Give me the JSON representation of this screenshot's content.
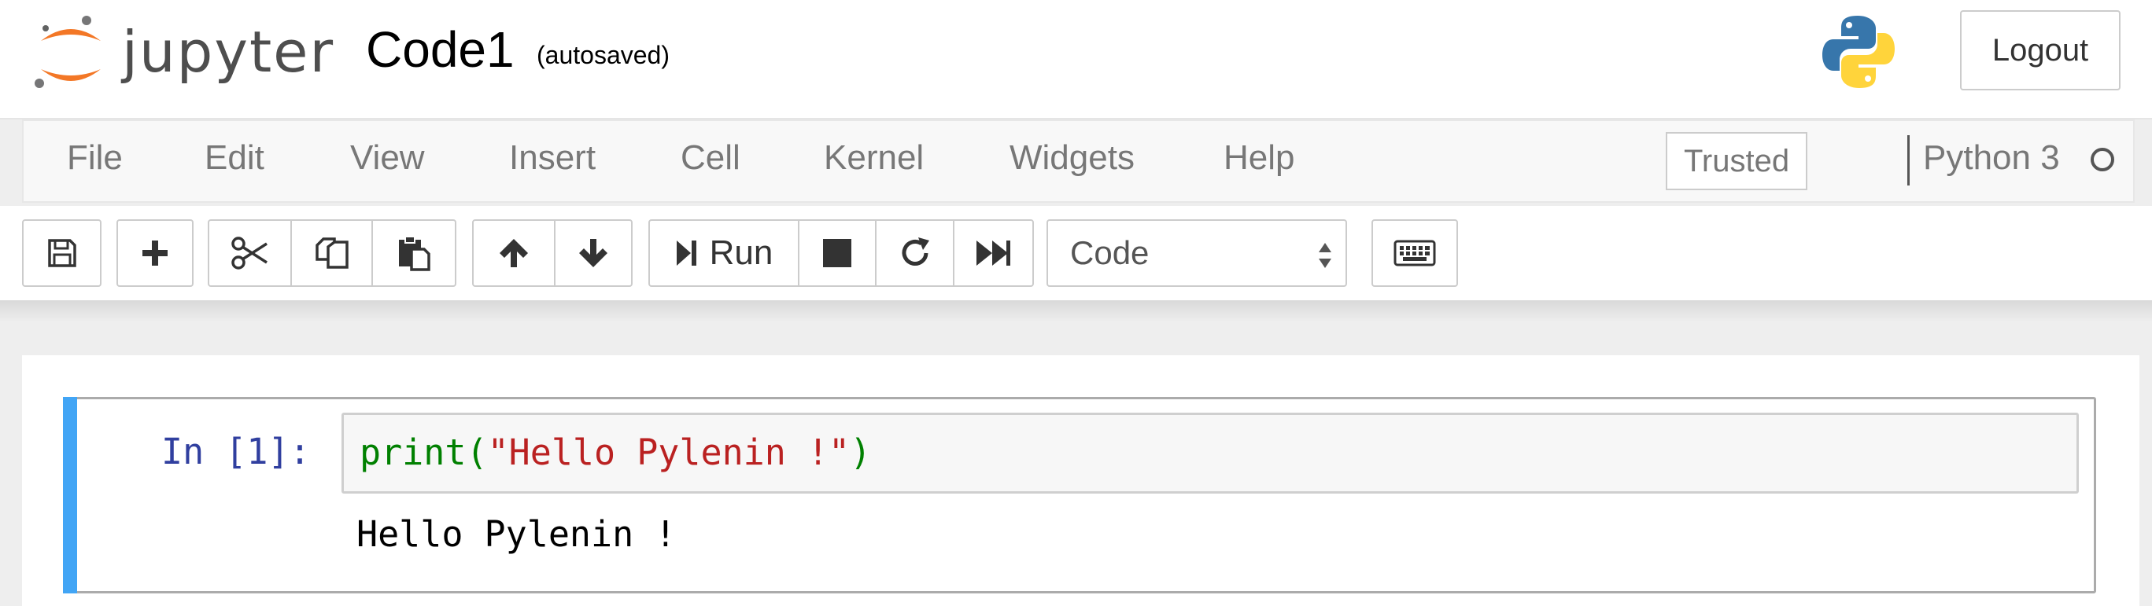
{
  "header": {
    "logo_text": "jupyter",
    "notebook_title": "Code1",
    "autosave_status": "(autosaved)",
    "logout_label": "Logout",
    "python_logo_icon": "python-logo-icon"
  },
  "menubar": {
    "items": [
      "File",
      "Edit",
      "View",
      "Insert",
      "Cell",
      "Kernel",
      "Widgets",
      "Help"
    ],
    "trusted_label": "Trusted",
    "kernel_name": "Python 3"
  },
  "toolbar": {
    "buttons": [
      "save-icon",
      "plus-icon",
      "cut-icon",
      "copy-icon",
      "paste-icon",
      "arrow-up-icon",
      "arrow-down-icon",
      "run",
      "stop-icon",
      "restart-icon",
      "fast-forward-icon",
      "keyboard-icon"
    ],
    "run_label": "Run",
    "cell_type_selected": "Code"
  },
  "cell": {
    "prompt": "In [1]:",
    "code": {
      "function": "print",
      "open_paren": "(",
      "string": "\"Hello Pylenin !\"",
      "close_paren": ")"
    },
    "output": "Hello Pylenin !"
  },
  "colors": {
    "accent_bar": "#42a5f5",
    "prompt": "#303f9f",
    "builtin": "#008000",
    "string": "#ba2121",
    "logo_orange": "#f37726"
  }
}
